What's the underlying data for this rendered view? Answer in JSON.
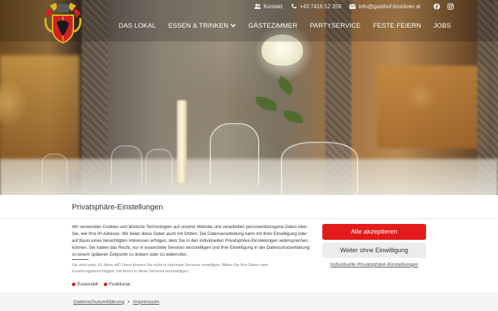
{
  "topbar": {
    "contact_label": "Kontakt",
    "phone": "+43 7416 52 359",
    "email": "info@gasthof-bruckner.at"
  },
  "nav": {
    "items": [
      "DAS LOKAL",
      "ESSEN & TRINKEN",
      "GÄSTEZIMMER",
      "PARTYSERVICE",
      "FESTE FEIERN",
      "JOBS"
    ]
  },
  "icons": {
    "contact": "users-icon",
    "phone": "phone-icon",
    "email": "envelope-icon",
    "facebook": "facebook-icon",
    "instagram": "instagram-icon",
    "dropdown": "chevron-down-icon"
  },
  "consent": {
    "title": "Privatsphäre-Einstellungen",
    "text": "Wir verwenden Cookies und ähnliche Technologien auf unserer Website und verarbeiten personenbezogene Daten über Sie, wie Ihre IP-Adresse. Wir teilen diese Daten auch mit Dritten. Die Datenverarbeitung kann mit Ihrer Einwilligung oder auf Basis eines berechtigten Interesses erfolgen, dem Sie in den individuellen Privatsphäre-Einstellungen widersprechen können. Sie haben das Recht, nur in essenzielle Services einzuwilligen und Ihre Einwilligung in der Datenschutzerklärung zu einem späteren Zeitpunkt zu ändern oder zu widerrufen.",
    "age_notice": "Sie sind unter 16 Jahre alt? Dann können Sie nicht in optionale Services einwilligen. Bitten Sie Ihre Eltern oder Erziehungsberechtigten, mit Ihnen in diese Services einzuwilligen.",
    "categories": [
      "Essenziell",
      "Funktional"
    ],
    "accept_all": "Alle akzeptieren",
    "continue_without": "Weiter ohne Einwilligung",
    "individual_settings": "Individuelle Privatsphäre-Einstellungen",
    "footer_links": [
      "Datenschutzerklärung",
      "Impressum"
    ],
    "footer_separator": "•"
  },
  "colors": {
    "accent": "#e31b1b",
    "category_dot": "#cc1a1a"
  }
}
